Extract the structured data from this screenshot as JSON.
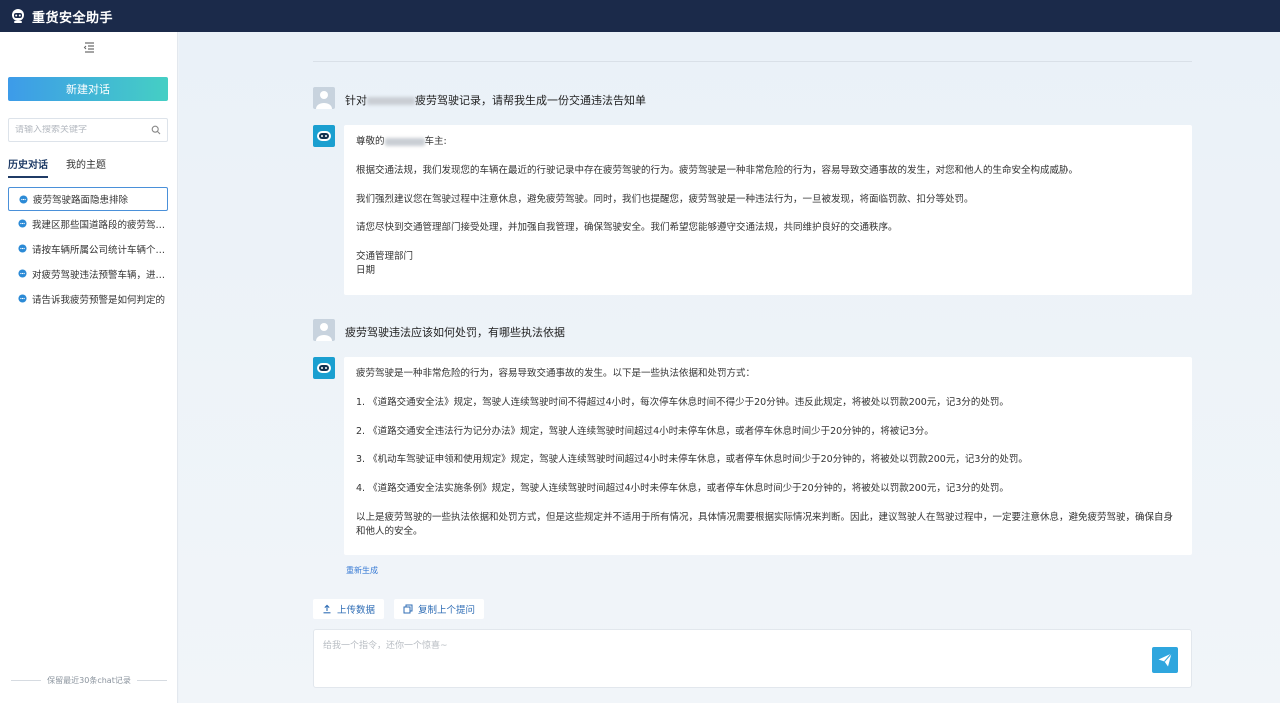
{
  "app": {
    "title": "重货安全助手"
  },
  "sidebar": {
    "new_chat_label": "新建对话",
    "search_placeholder": "请输入搜索关键字",
    "tabs": [
      {
        "label": "历史对话",
        "active": true
      },
      {
        "label": "我的主题",
        "active": false
      }
    ],
    "history": [
      {
        "label": "疲劳驾驶路面隐患排除",
        "active": true
      },
      {
        "label": "我建区那些国道路段的疲劳驾驶...",
        "active": false
      },
      {
        "label": "请按车辆所属公司统计车辆个数...",
        "active": false
      },
      {
        "label": "对疲劳驾驶违法预警车辆，进行...",
        "active": false
      },
      {
        "label": "请告诉我疲劳预警是如何判定的",
        "active": false
      }
    ],
    "footer_note": "保留最近30条chat记录"
  },
  "conversation": {
    "q1": {
      "prefix": "针对",
      "suffix": "疲劳驾驶记录，请帮我生成一份交通违法告知单"
    },
    "a1": {
      "salutation_prefix": "尊敬的",
      "salutation_suffix": "车主:",
      "p1": "根据交通法规，我们发现您的车辆在最近的行驶记录中存在疲劳驾驶的行为。疲劳驾驶是一种非常危险的行为，容易导致交通事故的发生，对您和他人的生命安全构成威胁。",
      "p2": "我们强烈建议您在驾驶过程中注意休息，避免疲劳驾驶。同时，我们也提醒您，疲劳驾驶是一种违法行为，一旦被发现，将面临罚款、扣分等处罚。",
      "p3": "请您尽快到交通管理部门接受处理，并加强自我管理，确保驾驶安全。我们希望您能够遵守交通法规，共同维护良好的交通秩序。",
      "sign1": "交通管理部门",
      "sign2": "日期"
    },
    "q2": "疲劳驾驶违法应该如何处罚，有哪些执法依据",
    "a2": {
      "intro": "疲劳驾驶是一种非常危险的行为，容易导致交通事故的发生。以下是一些执法依据和处罚方式：",
      "item1": "1. 《道路交通安全法》规定，驾驶人连续驾驶时间不得超过4小时，每次停车休息时间不得少于20分钟。违反此规定，将被处以罚款200元，记3分的处罚。",
      "item2": "2. 《道路交通安全违法行为记分办法》规定，驾驶人连续驾驶时间超过4小时未停车休息，或者停车休息时间少于20分钟的，将被记3分。",
      "item3": "3. 《机动车驾驶证申领和使用规定》规定，驾驶人连续驾驶时间超过4小时未停车休息，或者停车休息时间少于20分钟的，将被处以罚款200元，记3分的处罚。",
      "item4": "4. 《道路交通安全法实施条例》规定，驾驶人连续驾驶时间超过4小时未停车休息，或者停车休息时间少于20分钟的，将被处以罚款200元，记3分的处罚。",
      "conclusion": "以上是疲劳驾驶的一些执法依据和处罚方式，但是这些规定并不适用于所有情况，具体情况需要根据实际情况来判断。因此，建议驾驶人在驾驶过程中，一定要注意休息，避免疲劳驾驶，确保自身和他人的安全。"
    },
    "regenerate_label": "重新生成"
  },
  "actions": {
    "upload_label": "上传数据",
    "copy_label": "复制上个提问"
  },
  "input": {
    "placeholder": "给我一个指令，还你一个惊喜~"
  },
  "colors": {
    "topbar": "#1b2a4a",
    "accent": "#2fa6de",
    "gradient_start": "#3d9be9",
    "gradient_end": "#45cfc4"
  }
}
